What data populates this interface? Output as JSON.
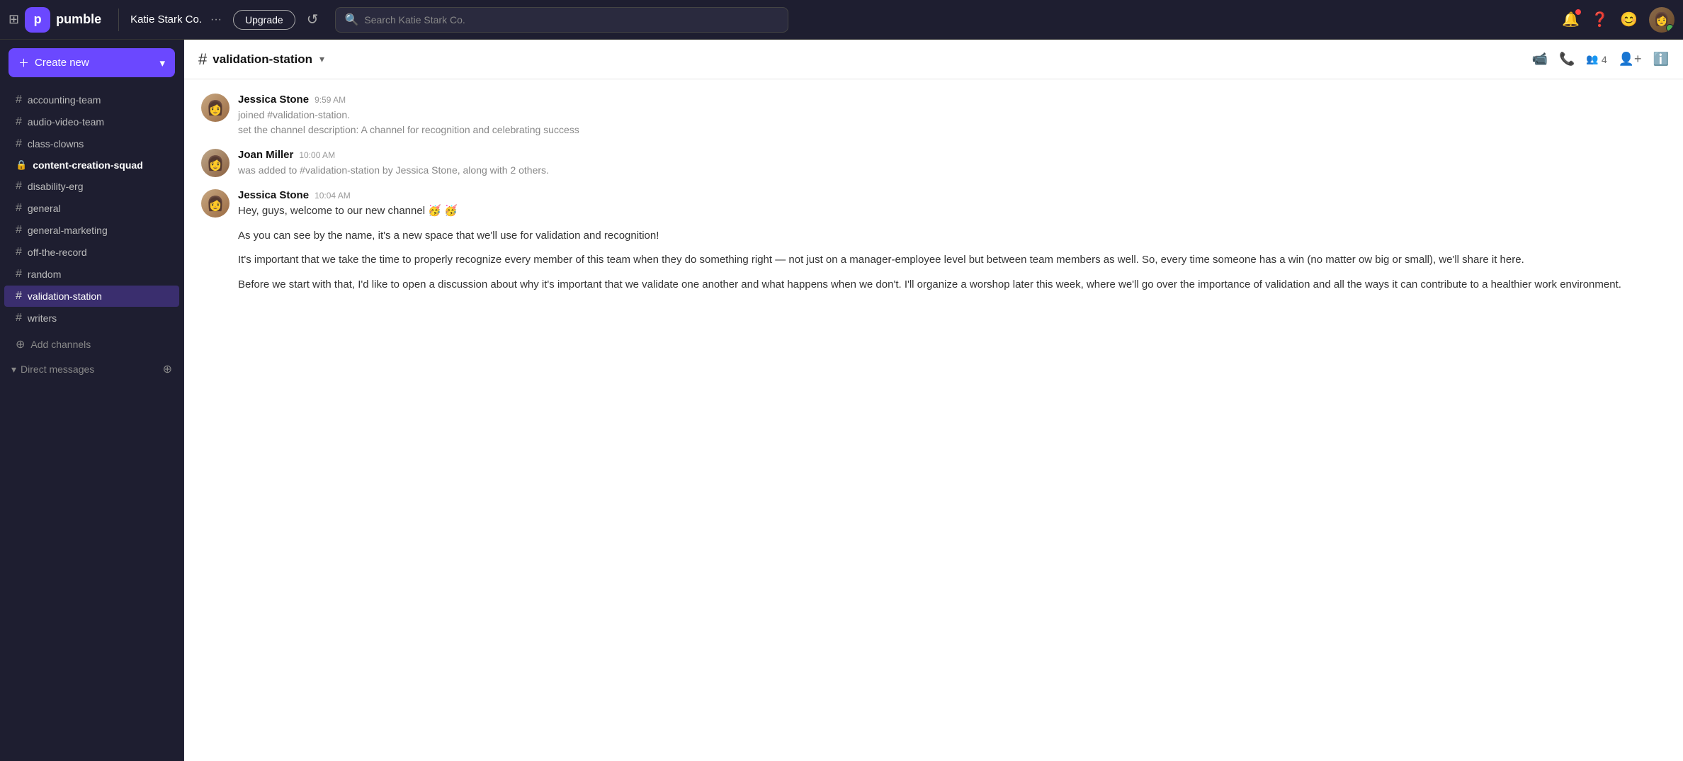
{
  "topbar": {
    "logo_text": "pumble",
    "workspace": "Katie Stark Co.",
    "more_label": "···",
    "upgrade_label": "Upgrade",
    "search_placeholder": "Search Katie Stark Co."
  },
  "sidebar": {
    "create_new_label": "Create new",
    "channels": [
      {
        "id": "accounting-team",
        "label": "accounting-team",
        "type": "hash",
        "active": false,
        "bold": false
      },
      {
        "id": "audio-video-team",
        "label": "audio-video-team",
        "type": "hash",
        "active": false,
        "bold": false
      },
      {
        "id": "class-clowns",
        "label": "class-clowns",
        "type": "hash",
        "active": false,
        "bold": false
      },
      {
        "id": "content-creation-squad",
        "label": "content-creation-squad",
        "type": "lock",
        "active": false,
        "bold": true
      },
      {
        "id": "disability-erg",
        "label": "disability-erg",
        "type": "hash",
        "active": false,
        "bold": false
      },
      {
        "id": "general",
        "label": "general",
        "type": "hash",
        "active": false,
        "bold": false
      },
      {
        "id": "general-marketing",
        "label": "general-marketing",
        "type": "hash",
        "active": false,
        "bold": false
      },
      {
        "id": "off-the-record",
        "label": "off-the-record",
        "type": "hash",
        "active": false,
        "bold": false
      },
      {
        "id": "random",
        "label": "random",
        "type": "hash",
        "active": false,
        "bold": false
      },
      {
        "id": "validation-station",
        "label": "validation-station",
        "type": "hash",
        "active": true,
        "bold": false
      },
      {
        "id": "writers",
        "label": "writers",
        "type": "hash",
        "active": false,
        "bold": false
      }
    ],
    "add_channels_label": "Add channels",
    "direct_messages_label": "Direct messages"
  },
  "chat": {
    "channel_name": "validation-station",
    "members_count": "4",
    "messages": [
      {
        "id": "msg1",
        "author": "Jessica Stone",
        "time": "9:59 AM",
        "avatar_type": "jessica",
        "lines": [
          "joined #validation-station.",
          "set the channel description: A channel for recognition and celebrating success"
        ],
        "is_join": true
      },
      {
        "id": "msg2",
        "author": "Joan Miller",
        "time": "10:00 AM",
        "avatar_type": "joan",
        "lines": [
          "was added to #validation-station by Jessica Stone, along with 2 others."
        ],
        "is_system": true
      },
      {
        "id": "msg3",
        "author": "Jessica Stone",
        "time": "10:04 AM",
        "avatar_type": "jessica",
        "paragraphs": [
          "Hey, guys, welcome to our new channel 🥳 🥳",
          "As you can see by the name, it's a new space that we'll use for validation and recognition!",
          "It's important that we take the time to properly recognize every member of this team when they do something right — not just on a manager-employee level but between team members as well. So, every time someone has a win (no matter ow big or small), we'll share it here.",
          "Before we start with that, I'd like to open a discussion about why it's important that we validate one another and what happens when we don't. I'll organize a worshop later this week, where we'll go over the importance of validation and all the ways it can contribute to a healthier work environment."
        ]
      }
    ]
  }
}
